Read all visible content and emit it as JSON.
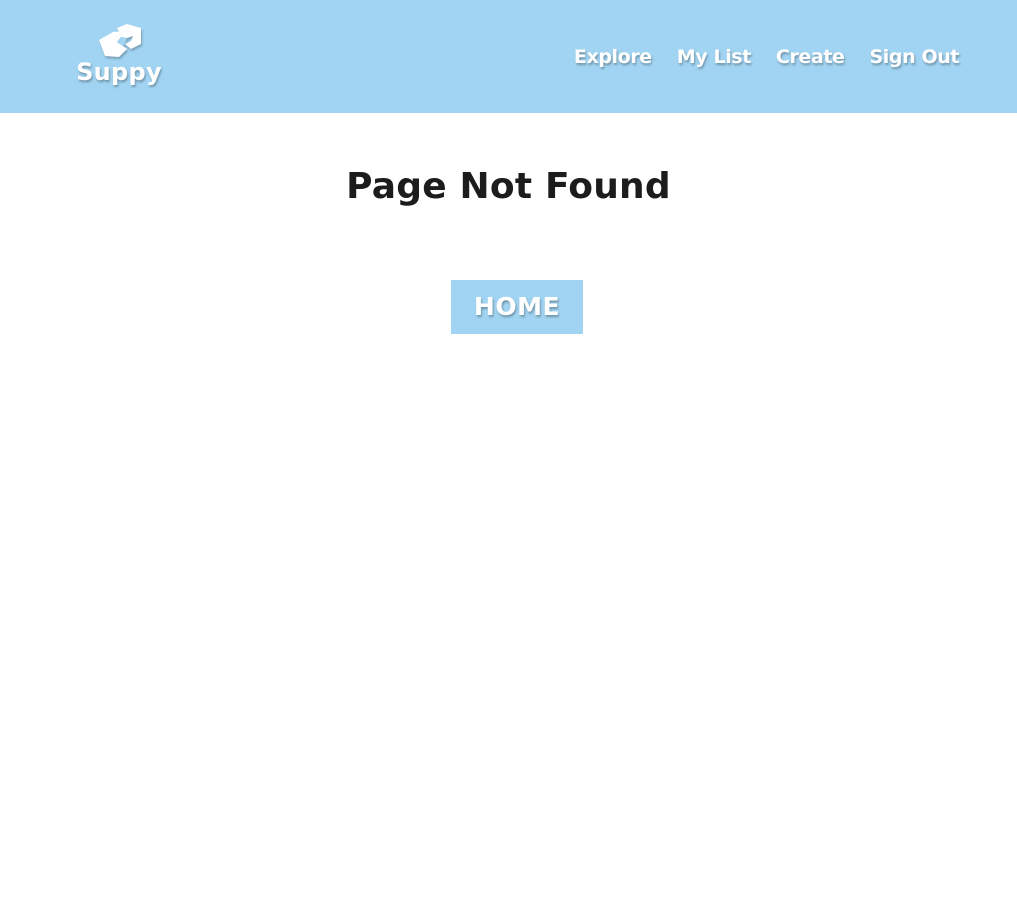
{
  "header": {
    "brand": {
      "name": "Suppy",
      "icon": "handshake-icon"
    },
    "nav": {
      "items": [
        {
          "label": "Explore"
        },
        {
          "label": "My List"
        },
        {
          "label": "Create"
        },
        {
          "label": "Sign Out"
        }
      ]
    },
    "background_color": "#a1d4f2"
  },
  "main": {
    "title": "Page Not Found",
    "home_button_label": "HOME",
    "button_color": "#a1d4f2",
    "title_color": "#1c1c1c"
  }
}
